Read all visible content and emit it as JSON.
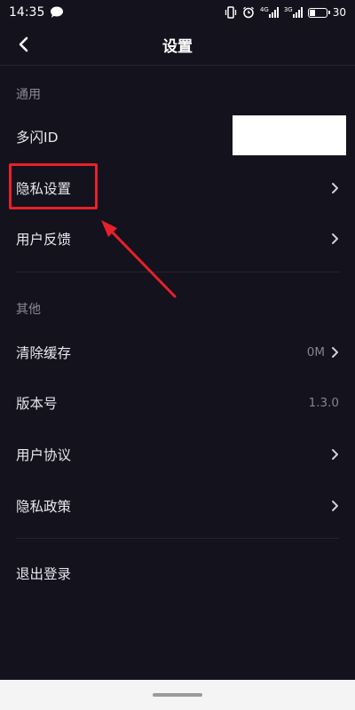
{
  "status_bar": {
    "time": "14:35",
    "battery_level": "30",
    "network_1": "4G",
    "network_2": "3G"
  },
  "header": {
    "title": "设置"
  },
  "sections": {
    "general": {
      "label": "通用",
      "items": [
        {
          "label": "多闪ID",
          "value": "",
          "has_chevron": false
        },
        {
          "label": "隐私设置",
          "value": "",
          "has_chevron": true
        },
        {
          "label": "用户反馈",
          "value": "",
          "has_chevron": true
        }
      ]
    },
    "other": {
      "label": "其他",
      "items": [
        {
          "label": "清除缓存",
          "value": "0M",
          "has_chevron": true
        },
        {
          "label": "版本号",
          "value": "1.3.0",
          "has_chevron": false
        },
        {
          "label": "用户协议",
          "value": "",
          "has_chevron": true
        },
        {
          "label": "隐私政策",
          "value": "",
          "has_chevron": true
        }
      ]
    }
  },
  "logout": {
    "label": "退出登录"
  },
  "annotation": {
    "highlight_color": "#e8202a"
  },
  "colors": {
    "background": "#13121d",
    "text": "#e8e8ee",
    "muted": "#8b8a94"
  }
}
